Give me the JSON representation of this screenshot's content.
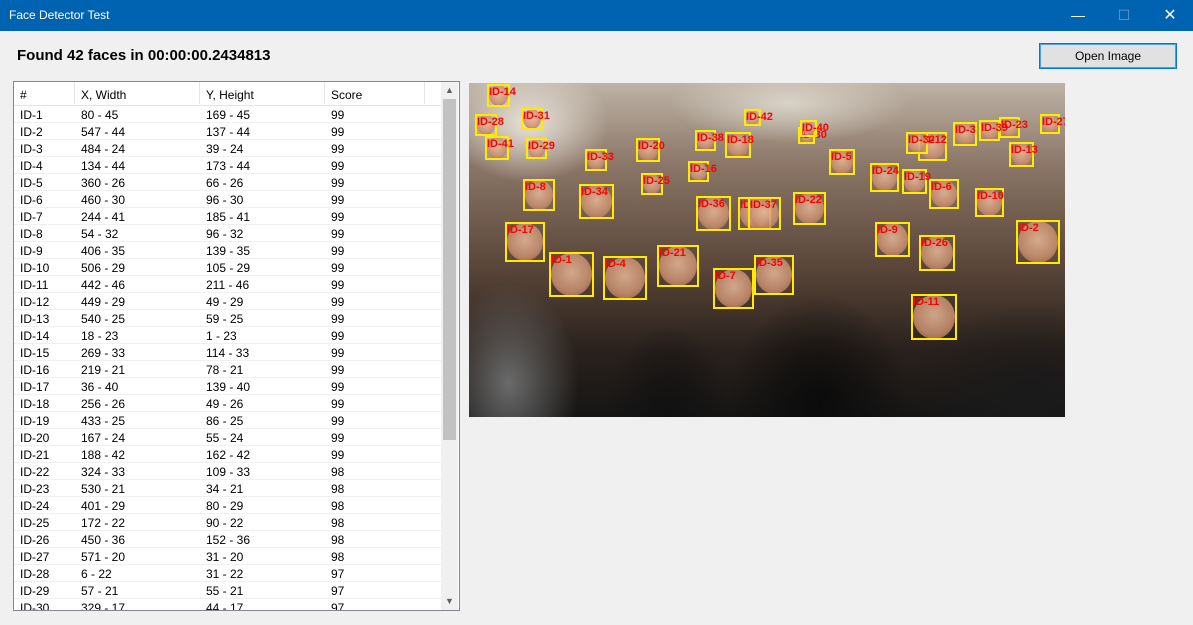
{
  "window": {
    "title": "Face Detector Test",
    "minimize_icon": "minimize-icon",
    "maximize_icon": "maximize-icon",
    "close_icon": "close-icon"
  },
  "headline": "Found 42 faces in 00:00:00.2434813",
  "open_button": "Open Image",
  "grid": {
    "headers": [
      "#",
      "X, Width",
      "Y, Height",
      "Score"
    ],
    "rows": [
      [
        "ID-1",
        "80 - 45",
        "169 - 45",
        "99"
      ],
      [
        "ID-2",
        "547 - 44",
        "137 - 44",
        "99"
      ],
      [
        "ID-3",
        "484 - 24",
        "39 - 24",
        "99"
      ],
      [
        "ID-4",
        "134 - 44",
        "173 - 44",
        "99"
      ],
      [
        "ID-5",
        "360 - 26",
        "66 - 26",
        "99"
      ],
      [
        "ID-6",
        "460 - 30",
        "96 - 30",
        "99"
      ],
      [
        "ID-7",
        "244 - 41",
        "185 - 41",
        "99"
      ],
      [
        "ID-8",
        "54 - 32",
        "96 - 32",
        "99"
      ],
      [
        "ID-9",
        "406 - 35",
        "139 - 35",
        "99"
      ],
      [
        "ID-10",
        "506 - 29",
        "105 - 29",
        "99"
      ],
      [
        "ID-11",
        "442 - 46",
        "211 - 46",
        "99"
      ],
      [
        "ID-12",
        "449 - 29",
        "49 - 29",
        "99"
      ],
      [
        "ID-13",
        "540 - 25",
        "59 - 25",
        "99"
      ],
      [
        "ID-14",
        "18 - 23",
        "1 - 23",
        "99"
      ],
      [
        "ID-15",
        "269 - 33",
        "114 - 33",
        "99"
      ],
      [
        "ID-16",
        "219 - 21",
        "78 - 21",
        "99"
      ],
      [
        "ID-17",
        "36 - 40",
        "139 - 40",
        "99"
      ],
      [
        "ID-18",
        "256 - 26",
        "49 - 26",
        "99"
      ],
      [
        "ID-19",
        "433 - 25",
        "86 - 25",
        "99"
      ],
      [
        "ID-20",
        "167 - 24",
        "55 - 24",
        "99"
      ],
      [
        "ID-21",
        "188 - 42",
        "162 - 42",
        "99"
      ],
      [
        "ID-22",
        "324 - 33",
        "109 - 33",
        "98"
      ],
      [
        "ID-23",
        "530 - 21",
        "34 - 21",
        "98"
      ],
      [
        "ID-24",
        "401 - 29",
        "80 - 29",
        "98"
      ],
      [
        "ID-25",
        "172 - 22",
        "90 - 22",
        "98"
      ],
      [
        "ID-26",
        "450 - 36",
        "152 - 36",
        "98"
      ],
      [
        "ID-27",
        "571 - 20",
        "31 - 20",
        "98"
      ],
      [
        "ID-28",
        "6 - 22",
        "31 - 22",
        "97"
      ],
      [
        "ID-29",
        "57 - 21",
        "55 - 21",
        "97"
      ],
      [
        "ID-30",
        "329 - 17",
        "44 - 17",
        "97"
      ]
    ],
    "scroll_up_icon": "chevron-up-icon",
    "scroll_down_icon": "chevron-down-icon"
  },
  "photo": {
    "labels": [
      "ID-1",
      "ID-2",
      "ID-3",
      "ID-4",
      "ID-5",
      "ID-6",
      "ID-7",
      "ID-8",
      "ID-9",
      "ID-10",
      "ID-11",
      "ID-12",
      "ID-13",
      "ID-14",
      "ID-15",
      "ID-16",
      "ID-17",
      "ID-18",
      "ID-19",
      "ID-20",
      "ID-21",
      "ID-22",
      "ID-23",
      "ID-24",
      "ID-25",
      "ID-26",
      "ID-27",
      "ID-28",
      "ID-29",
      "ID-30",
      "ID-31",
      "ID-32",
      "ID-33",
      "ID-34",
      "ID-35",
      "ID-36",
      "ID-37",
      "ID-38",
      "ID-39",
      "ID-40",
      "ID-41",
      "ID-42"
    ]
  },
  "colors": {
    "titlebar": "#0063b1",
    "box": "#ffea00",
    "label": "#ff0000"
  }
}
